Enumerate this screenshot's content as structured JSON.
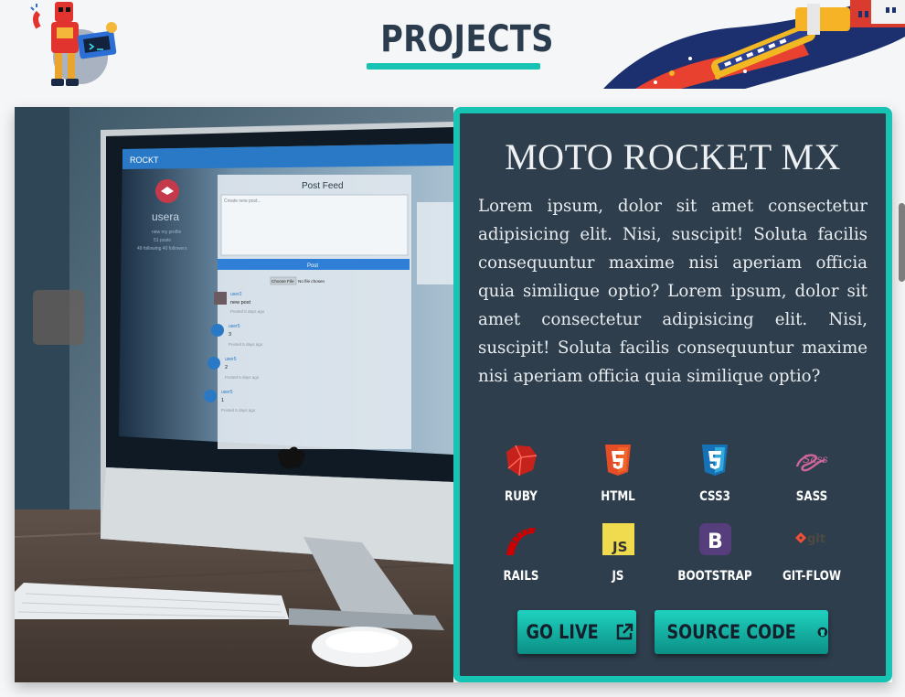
{
  "header": {
    "title": "PROJECTS"
  },
  "project": {
    "title": "MOTO ROCKET MX",
    "description": "Lorem ipsum, dolor sit amet consectetur adipisicing elit. Nisi, suscipit! Soluta facilis consequuntur maxime nisi aperiam officia quia similique optio? Lorem ipsum, dolor sit amet consectetur adipisicing elit. Nisi, suscipit! Soluta facilis consequuntur maxime nisi aperiam officia quia similique optio?",
    "technologies": [
      {
        "label": "RUBY",
        "icon": "ruby-icon"
      },
      {
        "label": "HTML",
        "icon": "html5-icon"
      },
      {
        "label": "CSS3",
        "icon": "css3-icon"
      },
      {
        "label": "SASS",
        "icon": "sass-icon"
      },
      {
        "label": "RAILS",
        "icon": "rails-icon"
      },
      {
        "label": "JS",
        "icon": "javascript-icon"
      },
      {
        "label": "BOOTSTRAP",
        "icon": "bootstrap-icon"
      },
      {
        "label": "GIT-FLOW",
        "icon": "git-icon"
      }
    ],
    "buttons": {
      "live": "GO LIVE",
      "source": "SOURCE CODE"
    }
  },
  "screen": {
    "brand": "ROCKT",
    "user": "usera",
    "user_meta": "new my profile",
    "user_posts": "51 posts",
    "user_follow": "49 following 40 followers",
    "feed_title": "Post Feed",
    "feed_placeholder": "Create new post...",
    "post_button": "Post",
    "file_button": "Choose File",
    "file_status": "No file chosen",
    "posts": [
      {
        "user": "user2",
        "text": "new post",
        "time": "Posted 5 days ago"
      },
      {
        "user": "user5",
        "text": "3",
        "time": "Posted 5 days ago"
      },
      {
        "user": "user5",
        "text": "2",
        "time": "Posted 5 days ago"
      },
      {
        "user": "user5",
        "text": "1",
        "time": "Posted 5 days ago"
      }
    ]
  },
  "colors": {
    "accent": "#17c3b2",
    "panel": "#2e3e4d",
    "title": "#2b3c4e"
  }
}
